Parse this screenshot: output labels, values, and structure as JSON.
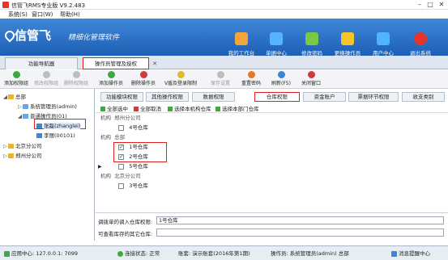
{
  "window": {
    "title": "信管飞RMS专业版 V9.2.483"
  },
  "menu": [
    "系统(S)",
    "窗口(W)",
    "帮助(H)"
  ],
  "banner": {
    "logo": "信管飞",
    "slogan": "精细化管理软件"
  },
  "top_buttons": [
    {
      "label": "我的工作台",
      "color": "#f3a43a"
    },
    {
      "label": "单据中心",
      "color": "#55b4ff"
    },
    {
      "label": "修改密码",
      "color": "#7ac943"
    },
    {
      "label": "更换操作员",
      "color": "#f3c52a"
    },
    {
      "label": "用户中心",
      "color": "#4fb3ff"
    },
    {
      "label": "退出系统",
      "color": "#e8332a"
    }
  ],
  "tabs": [
    {
      "label": "功能导航器"
    },
    {
      "label": "操作员管理及授权"
    }
  ],
  "toolbar": [
    {
      "label": "添加权限组",
      "color": "#3ea93e",
      "disabled": false
    },
    {
      "label": "修改权限组",
      "color": "#3ea93e",
      "disabled": true
    },
    {
      "label": "删除权限组",
      "color": "#d13b3b",
      "disabled": true
    },
    {
      "label": "添加操作员",
      "color": "#3ea93e",
      "disabled": false
    },
    {
      "label": "删除操作员",
      "color": "#d13b3b",
      "disabled": false
    },
    {
      "label": "V盾及登录限制",
      "color": "#e8b62a",
      "disabled": false
    },
    {
      "label": "保存设置",
      "color": "#888888",
      "disabled": true
    },
    {
      "label": "重置密码",
      "color": "#e27a2a",
      "disabled": false
    },
    {
      "label": "刷新(F5)",
      "color": "#3a86d4",
      "disabled": false
    },
    {
      "label": "关闭窗口",
      "color": "#d13b3b",
      "disabled": false
    }
  ],
  "tree": {
    "root": "总部",
    "nodes": [
      {
        "label": "系统管理员(admin)"
      },
      {
        "label": "普通操作员(01)"
      },
      {
        "label": "张磊(zhanglei)"
      },
      {
        "label": "李丽(00101)"
      },
      {
        "label": "北京分公司"
      },
      {
        "label": "郑州分公司"
      }
    ]
  },
  "subtabs": [
    "功能模块权限",
    "其他操作权限",
    "数据权限",
    "仓库权限",
    "资金账户",
    "票据环节权限",
    "收支类别"
  ],
  "actions": [
    {
      "label": "全部选中",
      "color": "#3ea93e"
    },
    {
      "label": "全部取消",
      "color": "#d13b3b"
    },
    {
      "label": "选择本机构仓库",
      "color": "#3ea93e"
    },
    {
      "label": "选择本部门仓库",
      "color": "#3ea93e"
    }
  ],
  "grid": {
    "org_header": "机构",
    "groups": [
      {
        "org": "郑州分公司",
        "rows": [
          {
            "name": "4号仓库",
            "checked": false
          }
        ]
      },
      {
        "org": "总部",
        "rows": [
          {
            "name": "1号仓库",
            "checked": true
          },
          {
            "name": "2号仓库",
            "checked": true
          },
          {
            "name": "5号仓库",
            "checked": false
          }
        ]
      },
      {
        "org": "北京分公司",
        "rows": [
          {
            "name": "3号仓库",
            "checked": false
          }
        ]
      }
    ]
  },
  "fields": {
    "default_label": "调拨单的调入仓库权限:",
    "default_value": "1号仓库",
    "other_label": "可查看库存的其它仓库:",
    "other_value": ""
  },
  "status": {
    "server": "应用中心: 127.0.0.1: 7099",
    "connection": "连接状态: 正常",
    "account": "账套: 演示账套(2016年第1期)",
    "operator": "操作员: 系统管理员(admin) 总部",
    "messages": "消息提醒中心"
  }
}
